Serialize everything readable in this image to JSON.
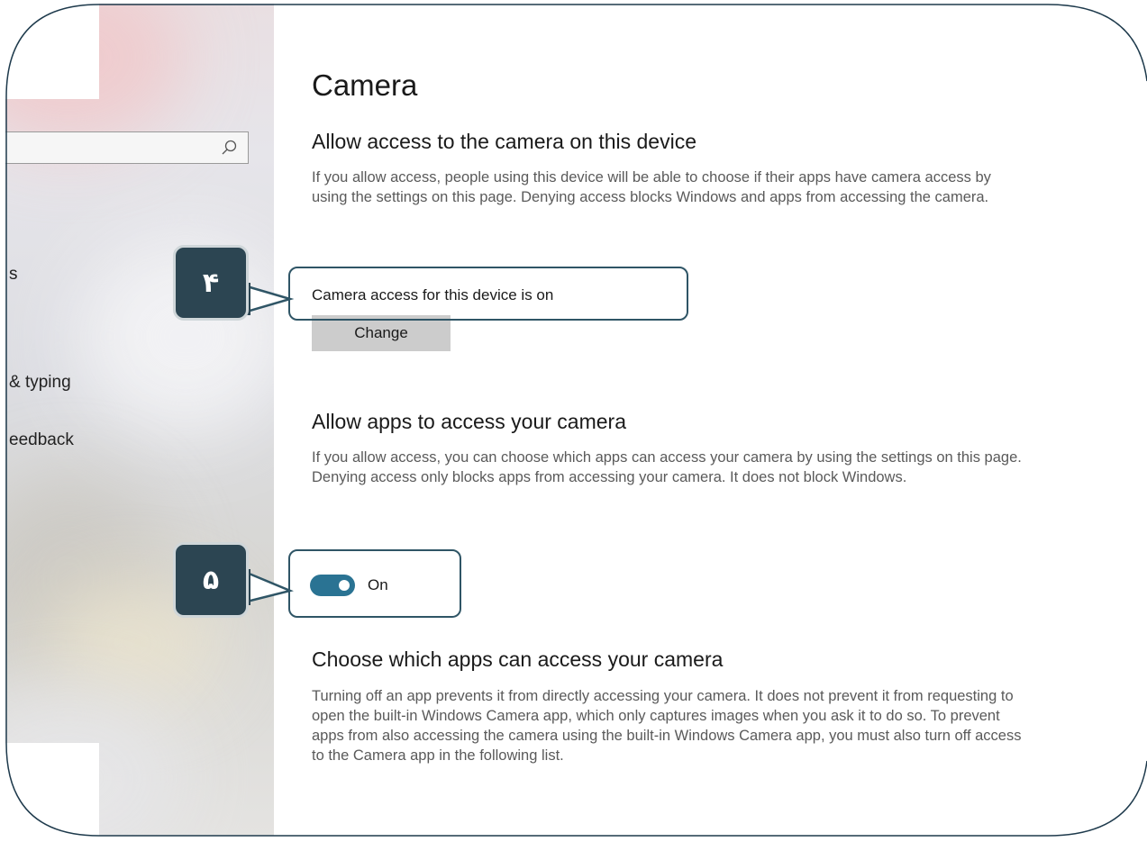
{
  "sidebar": {
    "search_icon": "search-icon",
    "items": [
      {
        "label": "s"
      },
      {
        "label": "& typing"
      },
      {
        "label": "eedback"
      }
    ]
  },
  "main": {
    "title": "Camera",
    "device_section": {
      "heading": "Allow access to the camera on this device",
      "description": "If you allow access, people using this device will be able to choose if their apps have camera access by using the settings on this page. Denying access blocks Windows and apps from accessing the camera.",
      "status": "Camera access for this device is on",
      "change_button": "Change"
    },
    "apps_section": {
      "heading": "Allow apps to access your camera",
      "description": "If you allow access, you can choose which apps can access your camera by using the settings on this page. Denying access only blocks apps from accessing your camera. It does not block Windows.",
      "toggle_state": "On",
      "toggle_on": true
    },
    "choose_section": {
      "heading": "Choose which apps can access your camera",
      "description": "Turning off an app prevents it from directly accessing your camera. It does not prevent it from requesting to open the built-in Windows Camera app, which only captures images when you ask it to do so. To prevent apps from also accessing the camera using the built-in Windows Camera app, you must also turn off access to the Camera app in the following list."
    }
  },
  "callouts": [
    {
      "number": "۴"
    },
    {
      "number": "۵"
    }
  ],
  "colors": {
    "toggle_on": "#2a7393",
    "callout_badge": "#2c4552",
    "callout_border": "#2f5566",
    "button_bg": "#cccccc"
  }
}
